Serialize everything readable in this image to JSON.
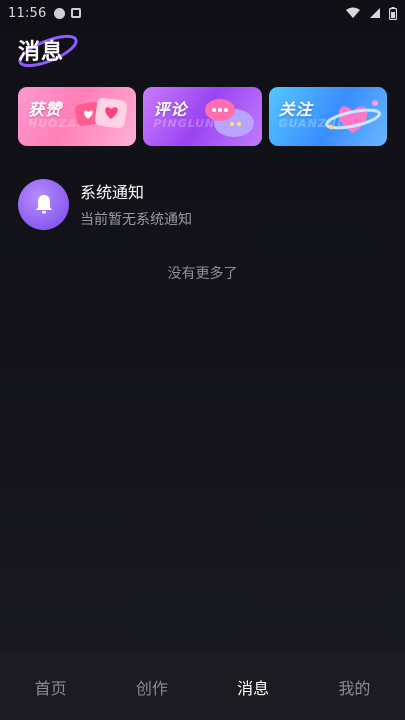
{
  "status_bar": {
    "time": "11:56",
    "icons": [
      "notification-dot-icon",
      "notification-square-icon",
      "wifi-icon",
      "signal-icon",
      "battery-icon"
    ]
  },
  "header": {
    "title": "消息"
  },
  "cards": [
    {
      "label": "获赞",
      "watermark": "HUOZAN",
      "icon": "heart-chat-icon",
      "accent": "#ff7fb6"
    },
    {
      "label": "评论",
      "watermark": "PINGLUN",
      "icon": "speech-bubble-icon",
      "accent": "#9b44f2"
    },
    {
      "label": "关注",
      "watermark": "GUANZHU",
      "icon": "heart-planet-icon",
      "accent": "#3a8dff"
    }
  ],
  "notices": [
    {
      "title": "系统通知",
      "subtitle": "当前暂无系统通知",
      "icon": "bell-icon"
    }
  ],
  "list_end_text": "没有更多了",
  "bottom_nav": {
    "items": [
      {
        "label": "首页",
        "active": false
      },
      {
        "label": "创作",
        "active": false
      },
      {
        "label": "消息",
        "active": true
      },
      {
        "label": "我的",
        "active": false
      }
    ]
  },
  "colors": {
    "background": "#0f0f15",
    "nav_background": "#1b1b21",
    "avatar_purple": "#8a5cf0",
    "muted_text": "#9a9aa6"
  }
}
